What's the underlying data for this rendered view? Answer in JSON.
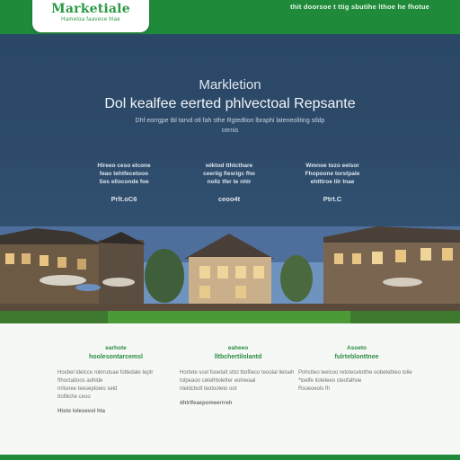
{
  "header": {
    "logo_title": "Marketiale",
    "logo_subtitle": "Hameloa faavese hlae",
    "tagline": "thit doorsoe t ttig sbutihe lthoe he fhotue"
  },
  "hero": {
    "kicker": "Markletion",
    "headline": "Dol kealfee eerted phlvectoal Repsante",
    "subtitle": "Dhf eorrgpe tbl tarvd otl fah sthe Rgtedtion lbraphi lateneoliting stldp cernis",
    "stats": [
      {
        "label": "Hlreeo ceso elcone\nfeao tehtfecetooo\nSes elloconde foe",
        "value": "Prlt.oC6"
      },
      {
        "label": "wiktod tthtcthare\nceeriig fiesrigc fho\nnollz tfer te nhlr",
        "value": "ceoo4t"
      },
      {
        "label": "Wmnoe tozo eelsor\nFhopoone torstpale\nehtttroe lilr lnae",
        "value": "Ptrt.C"
      }
    ]
  },
  "banner": {
    "alt": ""
  },
  "features": [
    {
      "kicker": "earhote",
      "title": "hoolesontarcemsl",
      "body": "Hosbel ldelcce rokrrutuae fottedale teptr fthoctaitoos aohlde\nnrlisnee teeseptoeio seld\n ttofiliche ceoo",
      "link": "Histo lolesevol hta"
    },
    {
      "kicker": "eaheeo",
      "title": "lltbchertilolantd",
      "body": "Hortete scel fooetalt sttcl ttiofileco teoolal llelseh tolpeaoo cetelhtoletter eolnwaal\nnleldcbolt teotooleto oot",
      "link": "dhlrlfeaepomeerrreh"
    },
    {
      "kicker": "Asoeto",
      "title": "fulrteblonttnee",
      "body": "Pohstteo leelcoo retotecelotthe oobetebteo tolle\n*toelfe lioteleeo cteofalhoe\nRsoeoeols fh",
      "link": ""
    }
  ],
  "colors": {
    "brand_green": "#1f8a3a",
    "hero_blue": "#2d4a6a",
    "feature_green": "#2b8d44"
  }
}
